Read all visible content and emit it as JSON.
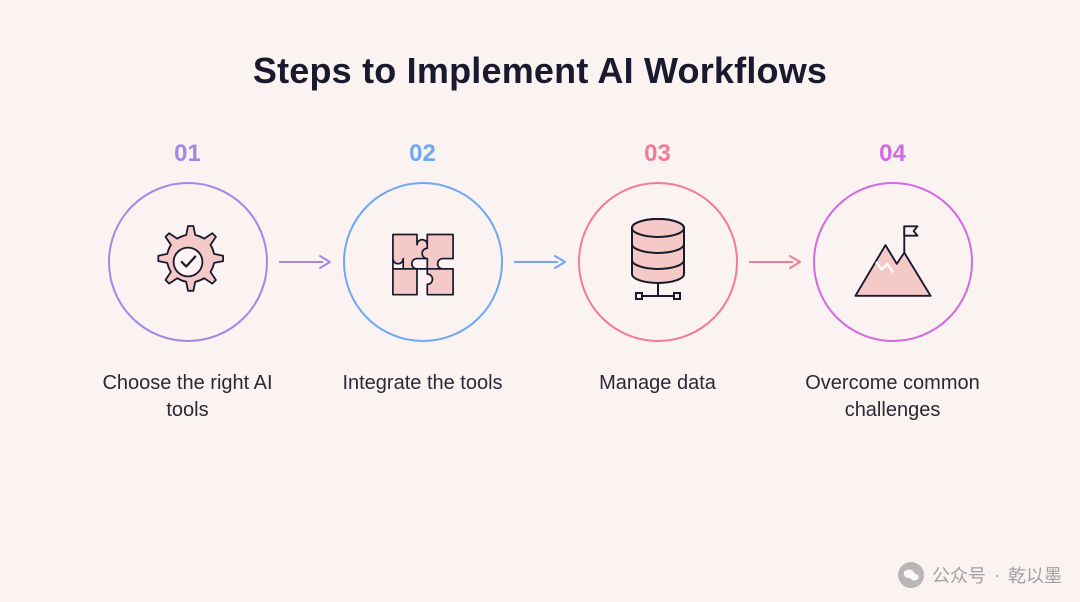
{
  "title": "Steps to Implement AI Workflows",
  "steps": [
    {
      "num": "01",
      "label": "Choose the right AI tools",
      "color": "#a686e6",
      "icon": "gear-check"
    },
    {
      "num": "02",
      "label": "Integrate the tools",
      "color": "#6fa8f5",
      "icon": "puzzle"
    },
    {
      "num": "03",
      "label": "Manage data",
      "color": "#f27b9a",
      "icon": "database"
    },
    {
      "num": "04",
      "label": "Overcome common challenges",
      "color": "#d26ae0",
      "icon": "mountain-flag"
    }
  ],
  "watermark": {
    "prefix": "公众号",
    "sep": "·",
    "name": "乾以墨"
  }
}
